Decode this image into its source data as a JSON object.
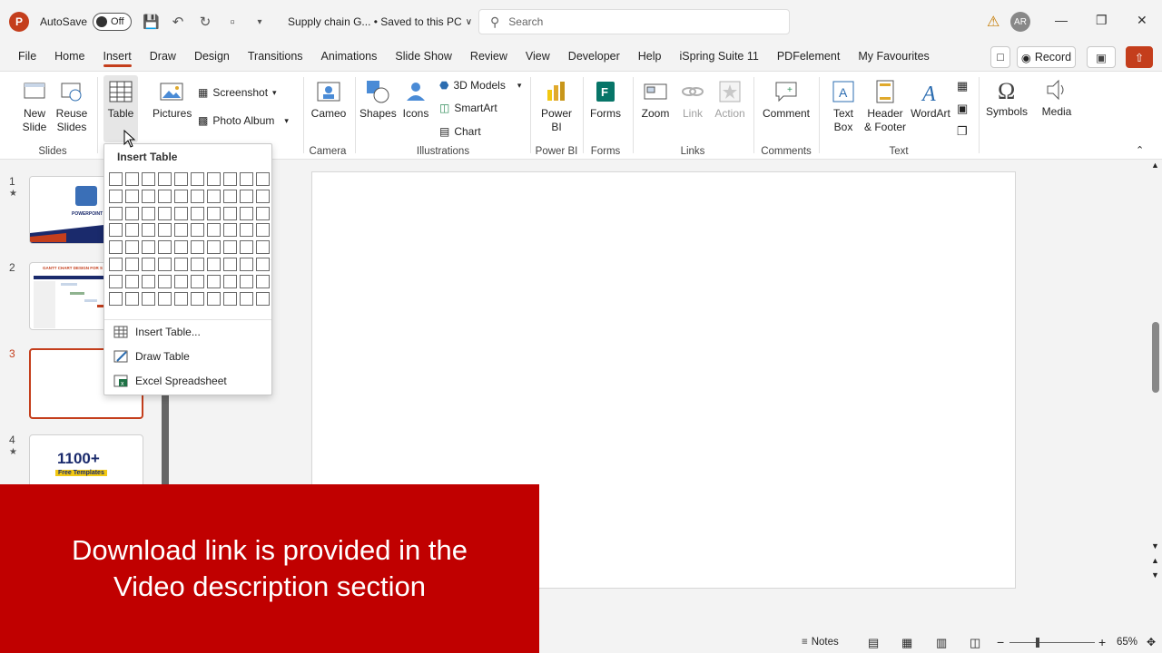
{
  "titlebar": {
    "app_letter": "P",
    "autosave_label": "AutoSave",
    "autosave_state": "Off",
    "doc_title": "Supply chain G... • Saved to this PC",
    "search_placeholder": "Search",
    "user_initials": "AR"
  },
  "tabs": [
    "File",
    "Home",
    "Insert",
    "Draw",
    "Design",
    "Transitions",
    "Animations",
    "Slide Show",
    "Review",
    "View",
    "Developer",
    "Help",
    "iSpring Suite 11",
    "PDFelement",
    "My Favourites"
  ],
  "active_tab": "Insert",
  "record_label": "Record",
  "ribbon": {
    "new_slide": "New\nSlide",
    "reuse_slides": "Reuse\nSlides",
    "slides_group": "Slides",
    "table": "Table",
    "pictures": "Pictures",
    "screenshot": "Screenshot",
    "photo_album": "Photo Album",
    "cameo": "Cameo",
    "camera_group": "Camera",
    "shapes": "Shapes",
    "icons": "Icons",
    "models_3d": "3D Models",
    "smartart": "SmartArt",
    "chart": "Chart",
    "illustrations_group": "Illustrations",
    "power_bi": "Power\nBI",
    "power_bi_group": "Power BI",
    "forms": "Forms",
    "forms_group": "Forms",
    "zoom": "Zoom",
    "link": "Link",
    "action": "Action",
    "links_group": "Links",
    "comment": "Comment",
    "comments_group": "Comments",
    "text_box": "Text\nBox",
    "header_footer": "Header\n& Footer",
    "wordart": "WordArt",
    "text_group": "Text",
    "symbols": "Symbols",
    "media": "Media"
  },
  "dropdown": {
    "title": "Insert Table",
    "grid_cols": 10,
    "grid_rows": 8,
    "items": [
      "Insert Table...",
      "Draw Table",
      "Excel Spreadsheet"
    ]
  },
  "thumbnails": {
    "numbers": [
      "1",
      "2",
      "3",
      "4"
    ],
    "thumb1_text": "POWERPOINT",
    "thumb2_text": "GANTT CHART DESIGN FOR S",
    "thumb4_big": "1100+",
    "thumb4_small": "Free Templates"
  },
  "banner": {
    "line1": "Download link is provided in the",
    "line2": "Video description section"
  },
  "statusbar": {
    "notes": "Notes",
    "zoom": "65%"
  },
  "colors": {
    "accent": "#c43e1c",
    "banner": "#c00000"
  }
}
